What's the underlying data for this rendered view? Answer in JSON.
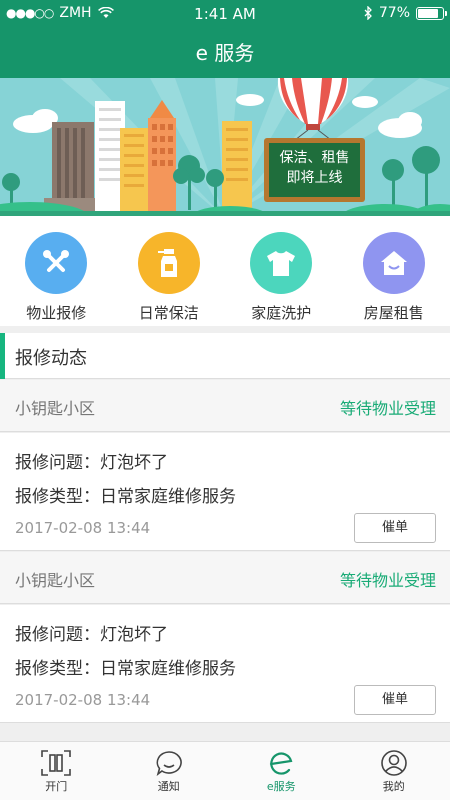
{
  "statusbar": {
    "carrier": "ZMH",
    "signal_dots": "●●●○○",
    "time": "1:41 AM",
    "battery": "77%",
    "battery_level": 0.77
  },
  "nav": {
    "title": "e 服务"
  },
  "banner": {
    "board_line1": "保洁、租售",
    "board_line2": "即将上线"
  },
  "services": [
    {
      "label": "物业报修",
      "icon": "tools-icon",
      "color": "#58aef0"
    },
    {
      "label": "日常保洁",
      "icon": "spray-bottle-icon",
      "color": "#f7b52a"
    },
    {
      "label": "家庭洗护",
      "icon": "tshirt-icon",
      "color": "#4cd6bd"
    },
    {
      "label": "房屋租售",
      "icon": "house-icon",
      "color": "#8f95f0"
    }
  ],
  "section": {
    "title": "报修动态"
  },
  "repairs": [
    {
      "community": "小钥匙小区",
      "status": "等待物业受理",
      "problem": "报修问题：灯泡坏了",
      "type": "报修类型：日常家庭维修服务",
      "date": "2017-02-08  13:44",
      "action": "催单"
    },
    {
      "community": "小钥匙小区",
      "status": "等待物业受理",
      "problem": "报修问题：灯泡坏了",
      "type": "报修类型：日常家庭维修服务",
      "date": "2017-02-08  13:44",
      "action": "催单"
    }
  ],
  "tabs": [
    {
      "label": "开门",
      "icon": "scan-door-icon"
    },
    {
      "label": "通知",
      "icon": "chat-bubble-icon"
    },
    {
      "label": "e服务",
      "icon": "e-service-icon",
      "active": true
    },
    {
      "label": "我的",
      "icon": "user-icon"
    }
  ],
  "colors": {
    "brand": "#16956a",
    "status_green": "#19ab76"
  }
}
